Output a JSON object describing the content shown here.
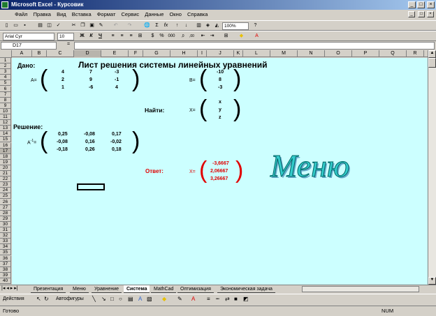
{
  "window": {
    "title": "Microsoft Excel - Курсовик"
  },
  "menu": [
    "Файл",
    "Правка",
    "Вид",
    "Вставка",
    "Формат",
    "Сервис",
    "Данные",
    "Окно",
    "Справка"
  ],
  "toolbar": {
    "zoom": "100%",
    "font": "Arial Cyr",
    "size": "10"
  },
  "formula_bar": {
    "cell": "D17",
    "fx": "="
  },
  "columns": [
    "A",
    "B",
    "C",
    "D",
    "E",
    "F",
    "G",
    "H",
    "I",
    "J",
    "K",
    "L",
    "M",
    "N",
    "O",
    "P",
    "Q",
    "R"
  ],
  "rows": [
    "1",
    "2",
    "3",
    "4",
    "5",
    "6",
    "7",
    "8",
    "9",
    "10",
    "11",
    "12",
    "13",
    "14",
    "15",
    "16",
    "17",
    "18",
    "19",
    "20",
    "21",
    "22",
    "23",
    "24",
    "25",
    "26",
    "27",
    "28",
    "29",
    "30",
    "31",
    "32",
    "33",
    "34",
    "35",
    "36",
    "37",
    "38",
    "39",
    "40"
  ],
  "sheet": {
    "title": "Лист решения системы линейных уравнений",
    "given": "Дано:",
    "A_label": "А=",
    "A": [
      [
        "4",
        "7",
        "-3"
      ],
      [
        "2",
        "9",
        "-1"
      ],
      [
        "1",
        "-6",
        "4"
      ]
    ],
    "B_label": "В=",
    "B": [
      "-10",
      "8",
      "-3"
    ],
    "find": "Найти:",
    "X_label": "X=",
    "X": [
      "x",
      "y",
      "z"
    ],
    "solution": "Решение:",
    "Ainv_label": "А",
    "Ainv_sup": "-1",
    "Ainv_eq": "=",
    "Ainv": [
      [
        "0,25",
        "-0,08",
        "0,17"
      ],
      [
        "-0,08",
        "0,16",
        "-0,02"
      ],
      [
        "-0,18",
        "0,26",
        "0,18"
      ]
    ],
    "answer": "Ответ:",
    "answer_X_label": "X=",
    "answer_values": [
      "-3,6667",
      "2,06667",
      "3,26667"
    ],
    "menu_art": "Меню"
  },
  "tabs": [
    "Презентация",
    "Меню",
    "Уравнение",
    "Система",
    "MathCad",
    "Оптимизация",
    "Экономическая задача"
  ],
  "active_tab": "Система",
  "draw_toolbar": {
    "actions": "Действия",
    "autoshapes": "Автофигуры"
  },
  "status": {
    "ready": "Готово",
    "num": "NUM"
  }
}
